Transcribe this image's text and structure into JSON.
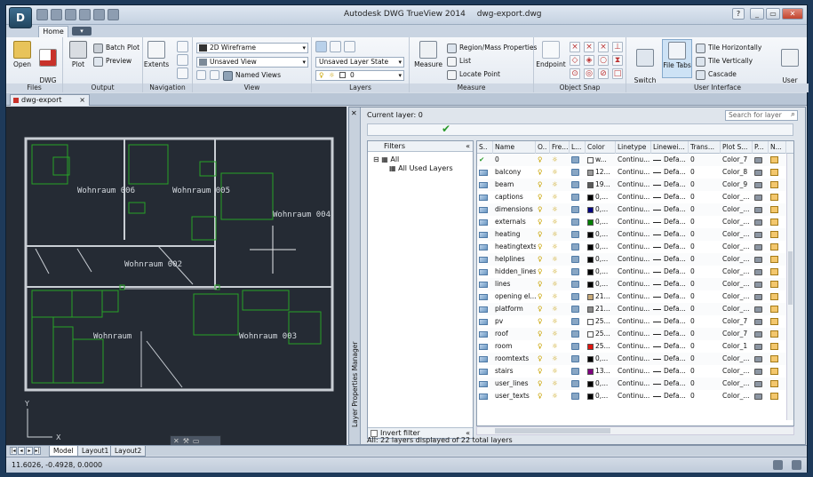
{
  "app": {
    "title": "Autodesk DWG TrueView 2014",
    "file": "dwg-export.dwg",
    "menu_letter": "D"
  },
  "window_controls": {
    "help": "?",
    "minimize": "_",
    "restore": "▭",
    "close": "✕"
  },
  "tabs": {
    "home": "Home"
  },
  "ribbon": {
    "files": {
      "title": "Files",
      "open": "Open",
      "dwg_convert": "DWG\nConvert"
    },
    "output": {
      "title": "Output",
      "plot": "Plot",
      "batch_plot": "Batch Plot",
      "preview": "Preview"
    },
    "navigation": {
      "title": "Navigation",
      "extents": "Extents"
    },
    "view": {
      "title": "View",
      "visual_style": "2D Wireframe",
      "saved_view": "Unsaved View",
      "named_views": "Named Views"
    },
    "layers": {
      "title": "Layers",
      "layer_state": "Unsaved Layer State",
      "current_layer": "0"
    },
    "measure": {
      "title": "Measure",
      "measure": "Measure",
      "region_mass": "Region/Mass Properties",
      "list": "List",
      "locate_point": "Locate Point"
    },
    "object_snap": {
      "title": "Object Snap",
      "endpoint": "Endpoint"
    },
    "user_interface": {
      "title": "User Interface",
      "switch_windows": "Switch\nWindows",
      "file_tabs": "File Tabs",
      "tile_h": "Tile Horizontally",
      "tile_v": "Tile Vertically",
      "cascade": "Cascade",
      "user_interface": "User\nInterface"
    }
  },
  "doc_tab": {
    "label": "dwg-export",
    "close": "×"
  },
  "drawing": {
    "rooms": [
      {
        "label": "Wohnraum 006"
      },
      {
        "label": "Wohnraum 005"
      },
      {
        "label": "Wohnraum 004"
      },
      {
        "label": "Wohnraum 002"
      },
      {
        "label": "Wohnraum"
      },
      {
        "label": "Wohnraum 003"
      }
    ],
    "ucs_x": "X",
    "ucs_y": "Y"
  },
  "layer_manager": {
    "title": "Layer Properties Manager",
    "close": "✕",
    "current_layer": "Current layer: 0",
    "search_placeholder": "Search for layer",
    "filters_title": "Filters",
    "tree_all": "All",
    "tree_used": "All Used Layers",
    "invert_filter": "Invert filter",
    "columns": [
      "S..",
      "Name",
      "O..",
      "Fre...",
      "L...",
      "Color",
      "Linetype",
      "Linewei...",
      "Trans...",
      "Plot S...",
      "P...",
      "N..."
    ],
    "layers": [
      {
        "name": "0",
        "color_text": "w...",
        "color": "#ffffff",
        "linetype": "Continu...",
        "lineweight": "Defa...",
        "trans": "0",
        "plot": "Color_7"
      },
      {
        "name": "balcony",
        "color_text": "12...",
        "color": "#9a9a9a",
        "linetype": "Continu...",
        "lineweight": "Defa...",
        "trans": "0",
        "plot": "Color_8"
      },
      {
        "name": "beam",
        "color_text": "19...",
        "color": "#5a5a5a",
        "linetype": "Continu...",
        "lineweight": "Defa...",
        "trans": "0",
        "plot": "Color_9"
      },
      {
        "name": "captions",
        "color_text": "0,...",
        "color": "#000000",
        "linetype": "Continu...",
        "lineweight": "Defa...",
        "trans": "0",
        "plot": "Color_..."
      },
      {
        "name": "dimensions",
        "color_text": "0,...",
        "color": "#00007f",
        "linetype": "Continu...",
        "lineweight": "Defa...",
        "trans": "0",
        "plot": "Color_..."
      },
      {
        "name": "externals",
        "color_text": "0,...",
        "color": "#007f00",
        "linetype": "Continu...",
        "lineweight": "Defa...",
        "trans": "0",
        "plot": "Color_..."
      },
      {
        "name": "heating",
        "color_text": "0,...",
        "color": "#000000",
        "linetype": "Continu...",
        "lineweight": "Defa...",
        "trans": "0",
        "plot": "Color_..."
      },
      {
        "name": "heatingtexts",
        "color_text": "0,...",
        "color": "#000000",
        "linetype": "Continu...",
        "lineweight": "Defa...",
        "trans": "0",
        "plot": "Color_..."
      },
      {
        "name": "helplines",
        "color_text": "0,...",
        "color": "#000000",
        "linetype": "Continu...",
        "lineweight": "Defa...",
        "trans": "0",
        "plot": "Color_..."
      },
      {
        "name": "hidden_lines",
        "color_text": "0,...",
        "color": "#000000",
        "linetype": "Continu...",
        "lineweight": "Defa...",
        "trans": "0",
        "plot": "Color_..."
      },
      {
        "name": "lines",
        "color_text": "0,...",
        "color": "#000000",
        "linetype": "Continu...",
        "lineweight": "Defa...",
        "trans": "0",
        "plot": "Color_..."
      },
      {
        "name": "opening el...",
        "color_text": "21...",
        "color": "#c8a978",
        "linetype": "Continu...",
        "lineweight": "Defa...",
        "trans": "0",
        "plot": "Color_..."
      },
      {
        "name": "platform",
        "color_text": "21...",
        "color": "#8a8a8a",
        "linetype": "Continu...",
        "lineweight": "Defa...",
        "trans": "0",
        "plot": "Color_..."
      },
      {
        "name": "pv",
        "color_text": "25...",
        "color": "#ffffff",
        "linetype": "Continu...",
        "lineweight": "Defa...",
        "trans": "0",
        "plot": "Color_7"
      },
      {
        "name": "roof",
        "color_text": "25...",
        "color": "#ffffff",
        "linetype": "Continu...",
        "lineweight": "Defa...",
        "trans": "0",
        "plot": "Color_7"
      },
      {
        "name": "room",
        "color_text": "25...",
        "color": "#e0140f",
        "linetype": "Continu...",
        "lineweight": "Defa...",
        "trans": "0",
        "plot": "Color_1"
      },
      {
        "name": "roomtexts",
        "color_text": "0,...",
        "color": "#000000",
        "linetype": "Continu...",
        "lineweight": "Defa...",
        "trans": "0",
        "plot": "Color_..."
      },
      {
        "name": "stairs",
        "color_text": "13...",
        "color": "#7f007f",
        "linetype": "Continu...",
        "lineweight": "Defa...",
        "trans": "0",
        "plot": "Color_..."
      },
      {
        "name": "user_lines",
        "color_text": "0,...",
        "color": "#000000",
        "linetype": "Continu...",
        "lineweight": "Defa...",
        "trans": "0",
        "plot": "Color_..."
      },
      {
        "name": "user_texts",
        "color_text": "0,...",
        "color": "#000000",
        "linetype": "Continu...",
        "lineweight": "Defa...",
        "trans": "0",
        "plot": "Color_..."
      }
    ],
    "status": "All: 22 layers displayed of 22 total layers"
  },
  "layout_tabs": [
    "Model",
    "Layout1",
    "Layout2"
  ],
  "status_bar": {
    "coords": "11.6026, -0.4928, 0.0000"
  }
}
